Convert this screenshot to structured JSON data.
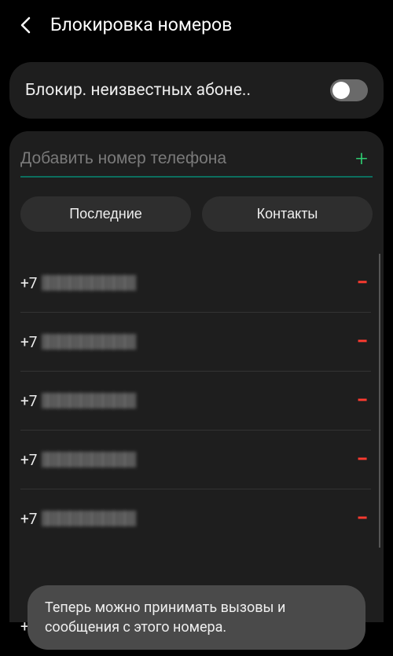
{
  "header": {
    "title": "Блокировка номеров"
  },
  "toggle": {
    "label": "Блокир. неизвестных абоне.."
  },
  "input": {
    "placeholder": "Добавить номер телефона"
  },
  "buttons": {
    "recent": "Последние",
    "contacts": "Контакты"
  },
  "numbers": {
    "prefix": "+7",
    "items": [
      {
        "prefix": "+7"
      },
      {
        "prefix": "+7"
      },
      {
        "prefix": "+7"
      },
      {
        "prefix": "+7"
      },
      {
        "prefix": "+7"
      },
      {
        "prefix": "+7"
      }
    ]
  },
  "toast": {
    "message": "Теперь можно принимать вызовы и сообщения с этого номера."
  }
}
